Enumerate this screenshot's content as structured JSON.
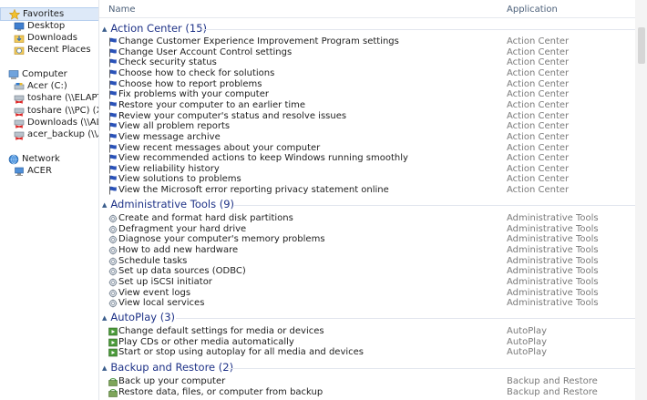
{
  "nav": {
    "items": [
      {
        "label": "Favorites",
        "icon": "star-icon",
        "selected": true
      },
      {
        "label": "Desktop",
        "icon": "desktop-icon"
      },
      {
        "label": "Downloads",
        "icon": "downloads-folder-icon"
      },
      {
        "label": "Recent Places",
        "icon": "recent-places-icon"
      },
      {
        "label": "Computer",
        "icon": "computer-icon"
      },
      {
        "label": "Acer (C:)",
        "icon": "drive-icon"
      },
      {
        "label": "toshare (\\\\ELAPTO",
        "icon": "network-drive-icon"
      },
      {
        "label": "toshare (\\\\PC) (X",
        "icon": "network-drive-icon"
      },
      {
        "label": "Downloads (\\\\ALL",
        "icon": "network-drive-icon"
      },
      {
        "label": "acer_backup (\\\\AL",
        "icon": "network-drive-icon"
      },
      {
        "label": "Network",
        "icon": "network-icon"
      },
      {
        "label": "ACER",
        "icon": "network-computer-icon"
      }
    ]
  },
  "columns": {
    "name": "Name",
    "application": "Application"
  },
  "groups": [
    {
      "title": "Action Center (15)",
      "icon": "flag-icon",
      "rows": [
        {
          "name": "Change Customer Experience Improvement Program settings",
          "app": "Action Center"
        },
        {
          "name": "Change User Account Control settings",
          "app": "Action Center"
        },
        {
          "name": "Check security status",
          "app": "Action Center"
        },
        {
          "name": "Choose how to check for solutions",
          "app": "Action Center"
        },
        {
          "name": "Choose how to report problems",
          "app": "Action Center"
        },
        {
          "name": "Fix problems with your computer",
          "app": "Action Center"
        },
        {
          "name": "Restore your computer to an earlier time",
          "app": "Action Center"
        },
        {
          "name": "Review your computer's status and resolve issues",
          "app": "Action Center"
        },
        {
          "name": "View all problem reports",
          "app": "Action Center"
        },
        {
          "name": "View message archive",
          "app": "Action Center"
        },
        {
          "name": "View recent messages about your computer",
          "app": "Action Center"
        },
        {
          "name": "View recommended actions to keep Windows running smoothly",
          "app": "Action Center"
        },
        {
          "name": "View reliability history",
          "app": "Action Center"
        },
        {
          "name": "View solutions to problems",
          "app": "Action Center"
        },
        {
          "name": "View the Microsoft error reporting privacy statement online",
          "app": "Action Center"
        }
      ]
    },
    {
      "title": "Administrative Tools (9)",
      "icon": "admin-tools-icon",
      "rows": [
        {
          "name": "Create and format hard disk partitions",
          "app": "Administrative Tools"
        },
        {
          "name": "Defragment your hard drive",
          "app": "Administrative Tools"
        },
        {
          "name": "Diagnose your computer's memory problems",
          "app": "Administrative Tools"
        },
        {
          "name": "How to add new hardware",
          "app": "Administrative Tools"
        },
        {
          "name": "Schedule tasks",
          "app": "Administrative Tools"
        },
        {
          "name": "Set up data sources (ODBC)",
          "app": "Administrative Tools"
        },
        {
          "name": "Set up iSCSI initiator",
          "app": "Administrative Tools"
        },
        {
          "name": "View event logs",
          "app": "Administrative Tools"
        },
        {
          "name": "View local services",
          "app": "Administrative Tools"
        }
      ]
    },
    {
      "title": "AutoPlay (3)",
      "icon": "autoplay-icon",
      "rows": [
        {
          "name": "Change default settings for media or devices",
          "app": "AutoPlay"
        },
        {
          "name": "Play CDs or other media automatically",
          "app": "AutoPlay"
        },
        {
          "name": "Start or stop using autoplay for all media and devices",
          "app": "AutoPlay"
        }
      ]
    },
    {
      "title": "Backup and Restore (2)",
      "icon": "backup-restore-icon",
      "rows": [
        {
          "name": "Back up your computer",
          "app": "Backup and Restore"
        },
        {
          "name": "Restore data, files, or computer from backup",
          "app": "Backup and Restore"
        }
      ]
    }
  ]
}
